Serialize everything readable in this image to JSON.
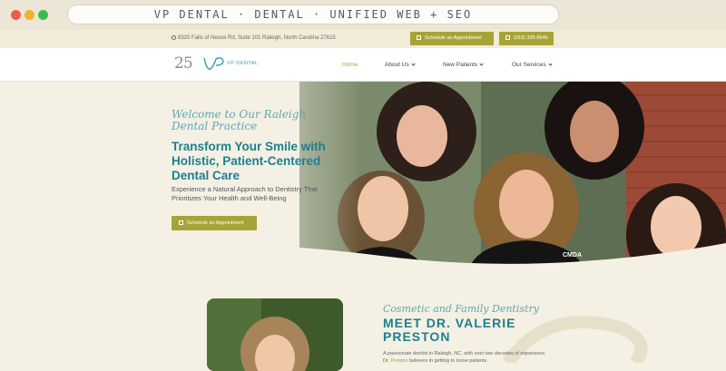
{
  "browser": {
    "url_text": "VP DENTAL · DENTAL · UNIFIED WEB + SEO"
  },
  "topbar": {
    "address": "8320 Falls of Neuse Rd, Suite 101 Raleigh, North Carolina 27615",
    "appointment_label": "Schedule an Appointment",
    "phone_label": "(919) 335-0546"
  },
  "nav": {
    "logo_number": "25",
    "logo_text": "VP DENTAL",
    "items": [
      {
        "label": "Home",
        "active": true
      },
      {
        "label": "About Us",
        "active": false
      },
      {
        "label": "New Patients",
        "active": false
      },
      {
        "label": "Our Services",
        "active": false
      }
    ]
  },
  "hero": {
    "welcome": "Welcome to Our Raleigh Dental Practice",
    "title": "Transform Your Smile with Holistic, Patient-Centered Dental Care",
    "subtitle": "Experience a Natural Approach to Dentistry That Prioritizes Your Health and Well-Being",
    "button_label": "Schedule an Appointment",
    "badge_text": "CMDA"
  },
  "about": {
    "script": "Cosmetic and Family Dentistry",
    "title": "MEET DR. VALERIE PRESTON",
    "text_start": "A passionate dentist in Raleigh, NC, with over two decades of experience. Dr. ",
    "text_highlight": "Preston",
    "text_end": " believes in getting to know patients"
  },
  "colors": {
    "accent": "#a7a437",
    "primary": "#1d7f90",
    "script": "#5fa7b2",
    "background": "#f4f0e4"
  },
  "icons": [
    "map-pin-icon",
    "calendar-icon",
    "phone-icon",
    "chevron-down-icon"
  ]
}
